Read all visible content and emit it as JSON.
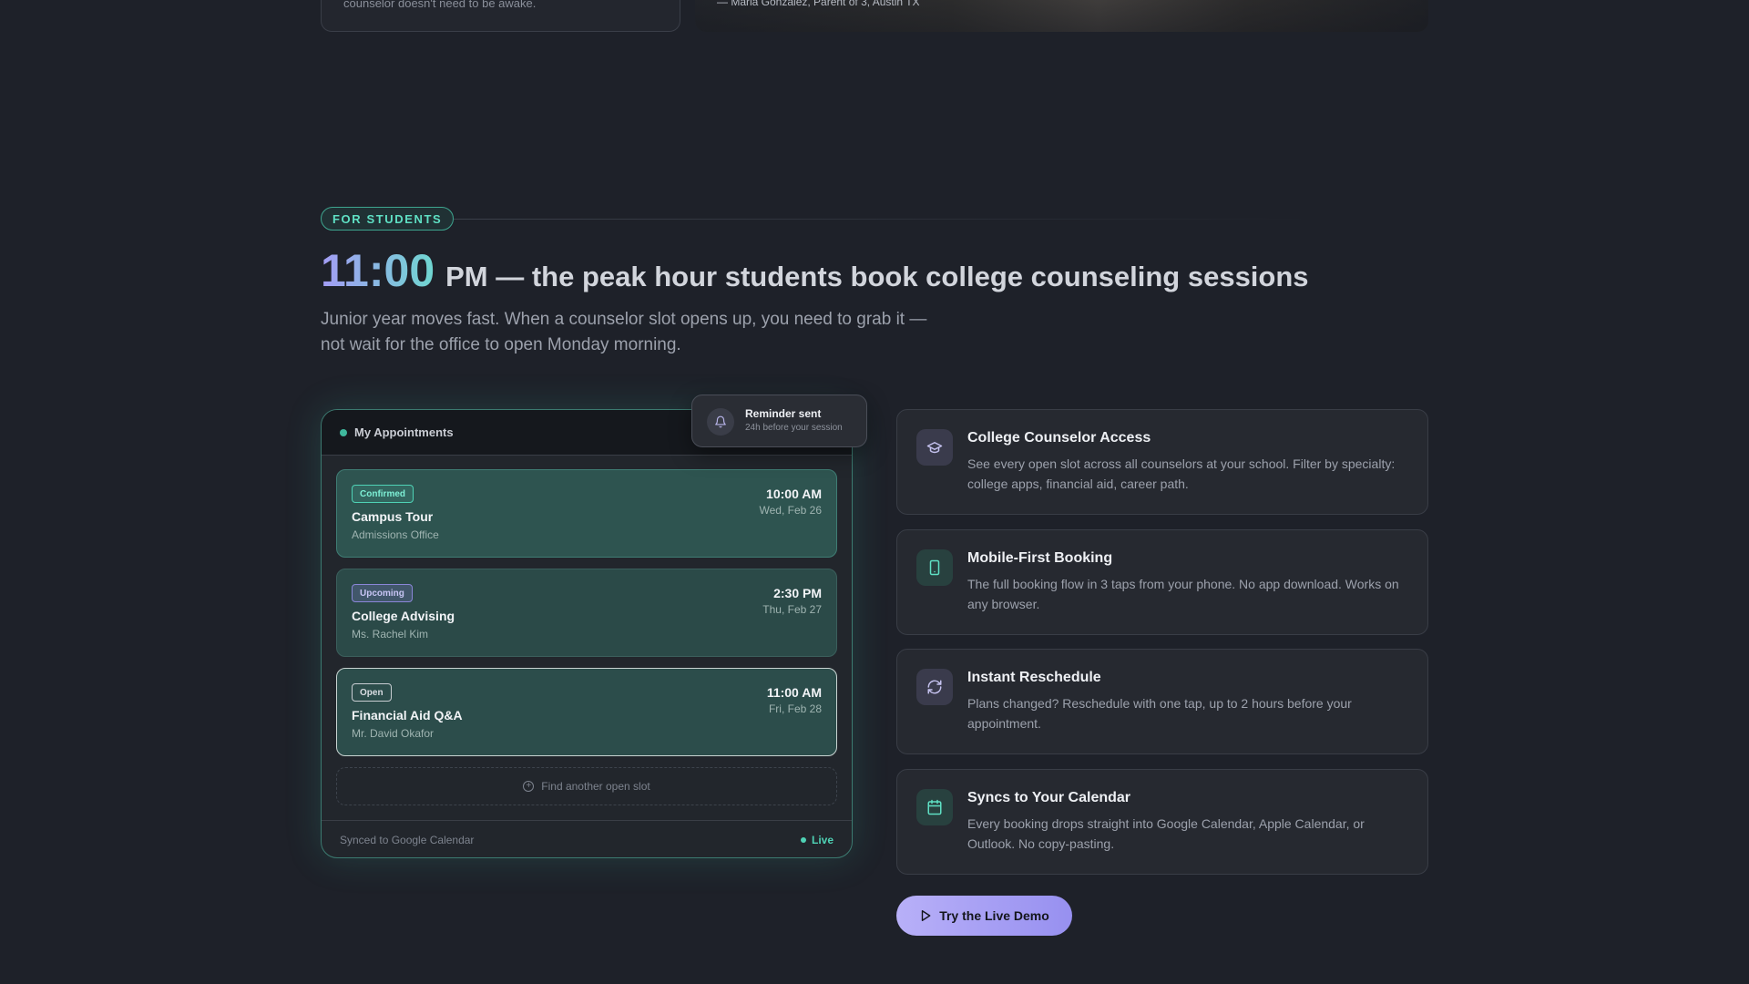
{
  "top": {
    "left_card_text": "counselor doesn't need to be awake.",
    "quote_attribution": "— Maria Gonzalez, Parent of 3, Austin TX"
  },
  "section": {
    "tag": "FOR STUDENTS",
    "headline_time": "11:00",
    "headline_rest": "PM — the peak hour students book college counseling sessions",
    "subtitle": "Junior year moves fast. When a counselor slot opens up, you need to grab it — not wait for the office to open Monday morning."
  },
  "panel": {
    "title": "My Appointments",
    "appointments": [
      {
        "status": "Confirmed",
        "name": "Campus Tour",
        "who": "Admissions Office",
        "time": "10:00 AM",
        "date": "Wed, Feb 26"
      },
      {
        "status": "Upcoming",
        "name": "College Advising",
        "who": "Ms. Rachel Kim",
        "time": "2:30 PM",
        "date": "Thu, Feb 27"
      },
      {
        "status": "Open",
        "name": "Financial Aid Q&A",
        "who": "Mr. David Okafor",
        "time": "11:00 AM",
        "date": "Fri, Feb 28"
      }
    ],
    "find_slot": "Find another open slot",
    "footer_sync": "Synced to Google Calendar",
    "footer_live": "Live"
  },
  "toast": {
    "title": "Reminder sent",
    "subtitle": "24h before your session"
  },
  "features": [
    {
      "icon": "graduation-cap-icon",
      "title": "College Counselor Access",
      "desc": "See every open slot across all counselors at your school. Filter by specialty: college apps, financial aid, career path."
    },
    {
      "icon": "phone-icon",
      "title": "Mobile-First Booking",
      "desc": "The full booking flow in 3 taps from your phone. No app download. Works on any browser."
    },
    {
      "icon": "refresh-icon",
      "title": "Instant Reschedule",
      "desc": "Plans changed? Reschedule with one tap, up to 2 hours before your appointment."
    },
    {
      "icon": "calendar-icon",
      "title": "Syncs to Your Calendar",
      "desc": "Every booking drops straight into Google Calendar, Apple Calendar, or Outlook. No copy-pasting."
    }
  ],
  "cta": {
    "label": "Try the Live Demo"
  },
  "colors": {
    "background": "#1e2129",
    "accent_teal": "#4fd2b5",
    "accent_purple": "#9790f0"
  }
}
